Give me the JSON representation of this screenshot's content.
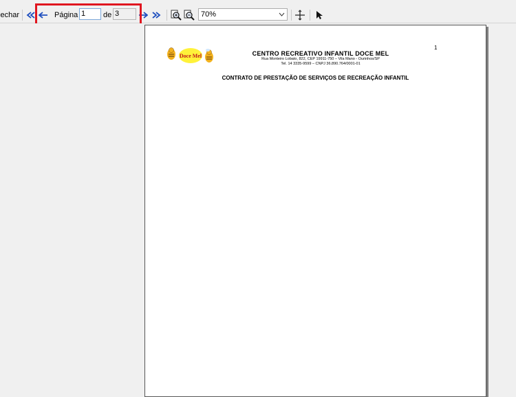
{
  "toolbar": {
    "close_label": "Fechar",
    "page_label": "Página",
    "page_value": "1",
    "of_label": "de",
    "total_pages": "3",
    "zoom_value": "70%"
  },
  "colors": {
    "highlight": "#e0151f",
    "nav_blue": "#1f4fbf"
  },
  "icons": [
    "first-page-icon",
    "prev-page-icon",
    "next-page-icon",
    "last-page-icon",
    "zoom-in-icon",
    "zoom-out-icon",
    "fit-page-icon",
    "pointer-icon"
  ],
  "document": {
    "page_number": "1",
    "logo_text": "Doce Mel",
    "company_name": "CENTRO RECREATIVO INFANTIL DOCE MEL",
    "address": "Rua Monteiro Lobato, 822, CEP 19911-750 – Vila Mano - Ourinhos/SP",
    "contact": "Tel. 14 3335-9599 – CNPJ 36.890.764/0001-01",
    "contract_title": "CONTRATO DE PRESTAÇÃO DE SERVIÇOS DE RECREAÇÃO INFANTIL"
  }
}
